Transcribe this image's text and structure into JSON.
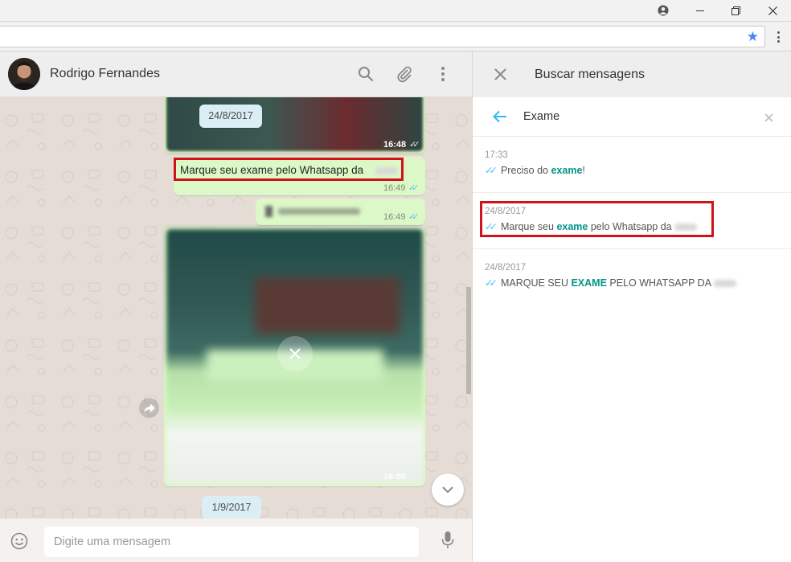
{
  "icons": {
    "account": "account-circle-icon",
    "minimize": "minimize-icon",
    "restore": "restore-icon",
    "close": "close-icon",
    "bookmark": "star-icon",
    "menu": "kebab-menu-icon",
    "search": "search-icon",
    "attach": "paperclip-icon",
    "emoji": "emoji-icon",
    "mic": "microphone-icon",
    "back": "arrow-back-icon"
  },
  "colors": {
    "highlight": "#d0121b",
    "accent": "#009688",
    "read_ticks": "#4fc3f7",
    "outgoing_bubble": "#dcf8c6",
    "chat_background": "#e5ddd5"
  },
  "chat": {
    "contact_name": "Rodrigo Fernandes",
    "messages": [
      {
        "type": "image",
        "time": "16:48"
      },
      {
        "type": "text",
        "text": "Marque seu exame pelo Whatsapp da",
        "time": "16:49",
        "highlighted": true
      },
      {
        "type": "file",
        "time": "16:49"
      },
      {
        "type": "image",
        "time": "16:50"
      }
    ],
    "date_chips": [
      "24/8/2017",
      "1/9/2017"
    ],
    "composer": {
      "placeholder": "Digite uma mensagem"
    }
  },
  "search": {
    "title": "Buscar mensagens",
    "query": "Exame",
    "results": [
      {
        "date": "17:33",
        "before": "Preciso do ",
        "match": "exame",
        "after": "!",
        "highlighted": false
      },
      {
        "date": "24/8/2017",
        "before": "Marque seu ",
        "match": "exame",
        "after": " pelo Whatsapp da",
        "highlighted": true
      },
      {
        "date": "24/8/2017",
        "before": "MARQUE SEU ",
        "match": "EXAME",
        "after": " PELO WHATSAPP DA",
        "highlighted": false
      }
    ]
  }
}
